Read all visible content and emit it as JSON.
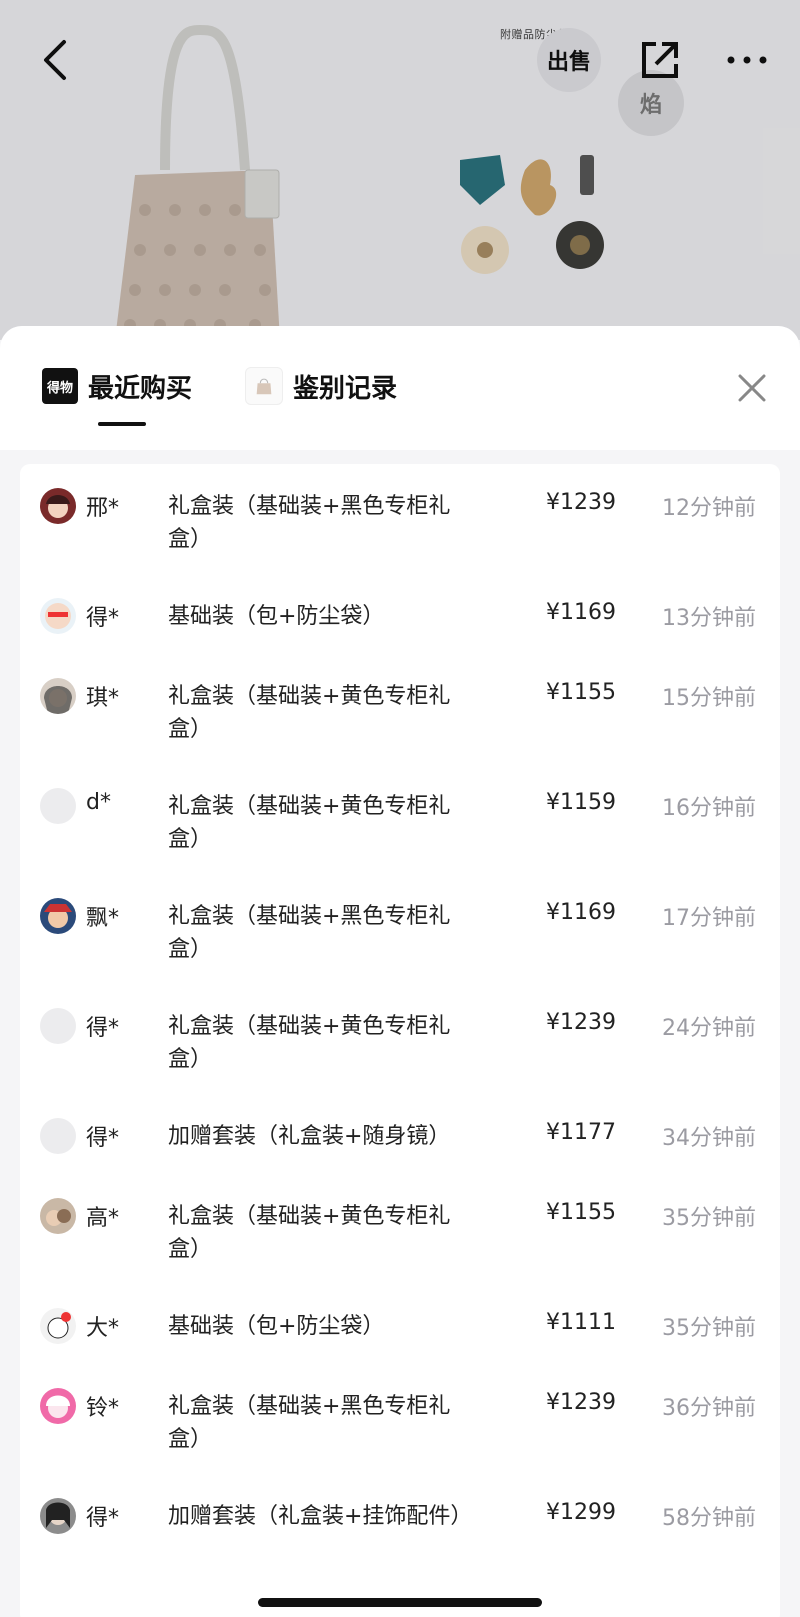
{
  "top": {
    "accessory_caption": "附赠品防尘袋",
    "sell_button_label": "出售",
    "flash_button_label": "焰"
  },
  "tabs": {
    "recent_logo": "得物",
    "recent_label": "最近购买",
    "auth_label": "鉴别记录"
  },
  "purchases": [
    {
      "user": "邢*",
      "item": "礼盒装（基础装+黑色专柜礼盒）",
      "price": "¥1239",
      "time": "12分钟前"
    },
    {
      "user": "得*",
      "item": "基础装（包+防尘袋）",
      "price": "¥1169",
      "time": "13分钟前"
    },
    {
      "user": "琪*",
      "item": "礼盒装（基础装+黄色专柜礼盒）",
      "price": "¥1155",
      "time": "15分钟前"
    },
    {
      "user": "d*",
      "item": "礼盒装（基础装+黄色专柜礼盒）",
      "price": "¥1159",
      "time": "16分钟前"
    },
    {
      "user": "飘*",
      "item": "礼盒装（基础装+黑色专柜礼盒）",
      "price": "¥1169",
      "time": "17分钟前"
    },
    {
      "user": "得*",
      "item": "礼盒装（基础装+黄色专柜礼盒）",
      "price": "¥1239",
      "time": "24分钟前"
    },
    {
      "user": "得*",
      "item": "加赠套装（礼盒装+随身镜）",
      "price": "¥1177",
      "time": "34分钟前"
    },
    {
      "user": "高*",
      "item": "礼盒装（基础装+黄色专柜礼盒）",
      "price": "¥1155",
      "time": "35分钟前"
    },
    {
      "user": "大*",
      "item": "基础装（包+防尘袋）",
      "price": "¥1111",
      "time": "35分钟前"
    },
    {
      "user": "铃*",
      "item": "礼盒装（基础装+黑色专柜礼盒）",
      "price": "¥1239",
      "time": "36分钟前"
    },
    {
      "user": "得*",
      "item": "加赠套装（礼盒装+挂饰配件）",
      "price": "¥1299",
      "time": "58分钟前"
    }
  ]
}
